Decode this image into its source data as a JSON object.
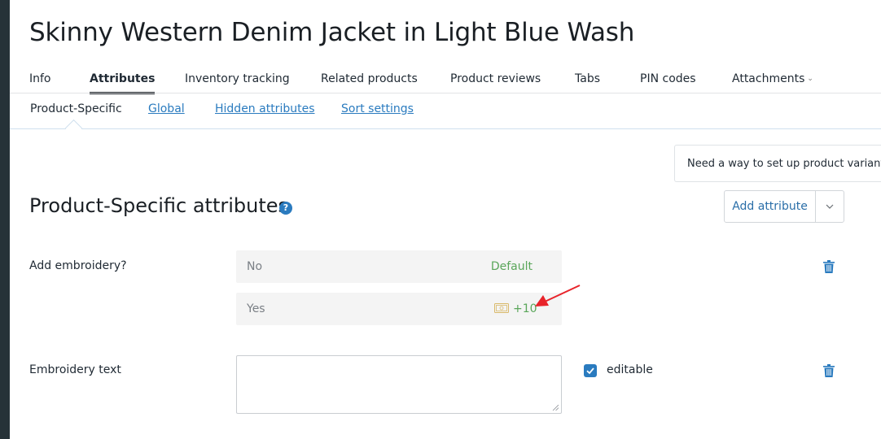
{
  "product": {
    "title": "Skinny Western Denim Jacket in Light Blue Wash"
  },
  "tabs": [
    {
      "label": "Info"
    },
    {
      "label": "Attributes"
    },
    {
      "label": "Inventory tracking"
    },
    {
      "label": "Related products"
    },
    {
      "label": "Product reviews"
    },
    {
      "label": "Tabs"
    },
    {
      "label": "PIN codes"
    },
    {
      "label": "Attachments"
    }
  ],
  "subtabs": [
    {
      "label": "Product-Specific"
    },
    {
      "label": "Global"
    },
    {
      "label": "Hidden attributes"
    },
    {
      "label": "Sort settings"
    }
  ],
  "hint": {
    "text": "Need a way to set up product variants?"
  },
  "section": {
    "title": "Product-Specific attributes",
    "help_icon": "?",
    "add_attribute_label": "Add attribute"
  },
  "attributes": [
    {
      "label": "Add embroidery?",
      "options": [
        {
          "name": "No",
          "modifier": "Default"
        },
        {
          "name": "Yes",
          "modifier": "+10",
          "modifier_icon": "money-icon"
        }
      ]
    },
    {
      "label": "Embroidery text",
      "value": "",
      "checkbox_label": "editable",
      "checkbox_checked": true
    }
  ],
  "colors": {
    "accent": "#2a7bbf",
    "price_modifier": "#5aa65a",
    "annotation_arrow": "#e8232a",
    "rail": "#263238"
  },
  "active_tab": "Attributes",
  "active_subtab": "Product-Specific"
}
